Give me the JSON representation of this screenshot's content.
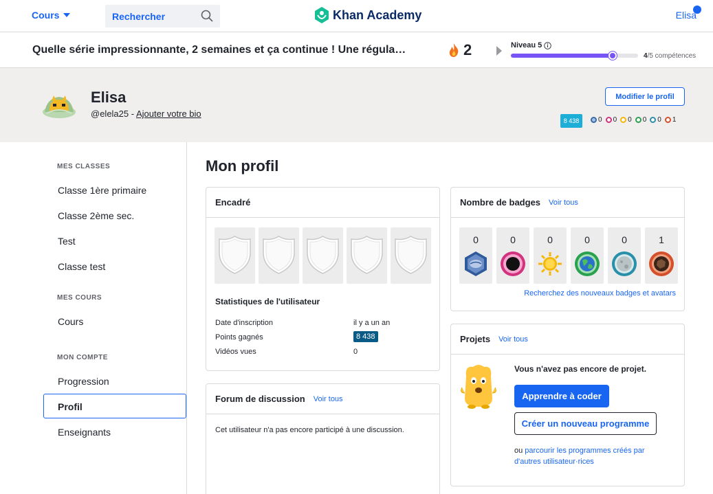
{
  "nav": {
    "courses_label": "Cours",
    "search_placeholder": "Rechercher",
    "logo_text": "Khan Academy",
    "user_name": "Elisa"
  },
  "streak": {
    "message": "Quelle série impressionnante, 2 semaines et ça continue ! Une régula…",
    "count": "2",
    "level_label": "Niveau 5",
    "level_progress_fraction": 0.8,
    "skills_done": "4",
    "skills_total": "/5 compétences"
  },
  "profile": {
    "name": "Elisa",
    "handle": "@elela25 - ",
    "add_bio": "Ajouter votre bio",
    "edit_button": "Modifier le profil",
    "points": "8 438",
    "badge_counts": [
      {
        "icon": "meteorite-badge-icon",
        "count": "0",
        "color": "#3a6aa8"
      },
      {
        "icon": "moon-badge-icon",
        "count": "0",
        "color": "#d2337f"
      },
      {
        "icon": "earth-badge-icon",
        "count": "0",
        "color": "#f5b70c"
      },
      {
        "icon": "sun-badge-icon",
        "count": "0",
        "color": "#2aa14e"
      },
      {
        "icon": "black-hole-badge-icon",
        "count": "0",
        "color": "#2a8fa8"
      },
      {
        "icon": "challenge-patch-icon",
        "count": "1",
        "color": "#d4502b"
      }
    ]
  },
  "sidebar": {
    "classes_heading": "MES CLASSES",
    "classes": [
      "Classe 1ère primaire",
      "Classe 2ème sec.",
      "Test",
      "Classe test"
    ],
    "courses_heading": "MES COURS",
    "courses": [
      "Cours"
    ],
    "account_heading": "MON COMPTE",
    "account": [
      "Progression",
      "Profil",
      "Enseignants"
    ]
  },
  "main": {
    "title": "Mon profil",
    "featured": {
      "title": "Encadré",
      "stats_title": "Statistiques de l'utilisateur",
      "stats": [
        {
          "label": "Date d'inscription",
          "value": "il y a un an"
        },
        {
          "label": "Points gagnés",
          "value": "8 438"
        },
        {
          "label": "Vidéos vues",
          "value": "0"
        }
      ]
    },
    "badges": {
      "title": "Nombre de badges",
      "see_all": "Voir tous",
      "counts": [
        "0",
        "0",
        "0",
        "0",
        "0",
        "1"
      ],
      "search_link": "Recherchez des nouveaux badges et avatars"
    },
    "discussion": {
      "title": "Forum de discussion",
      "see_all": "Voir tous",
      "empty": "Cet utilisateur n'a pas encore participé à une discussion."
    },
    "projects": {
      "title": "Projets",
      "see_all": "Voir tous",
      "empty": "Vous n'avez pas encore de projet.",
      "learn_button": "Apprendre à coder",
      "new_button": "Créer un nouveau programme",
      "or_text": "ou ",
      "browse_link_1": "parcourir les programmes créés par",
      "browse_link_2": "d'autres utilisateur·rices"
    }
  }
}
